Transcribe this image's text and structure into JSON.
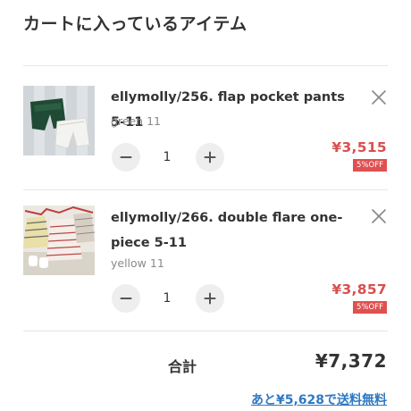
{
  "page": {
    "title": "カートに入っているアイテム"
  },
  "cart": {
    "items": [
      {
        "name": "ellymolly/256. flap pocket pants 5-11",
        "variant": "green 11",
        "quantity": "1",
        "price": "¥3,515",
        "discount_badge": "5%OFF"
      },
      {
        "name": "ellymolly/266. double flare one-piece 5-11",
        "variant": "yellow 11",
        "quantity": "1",
        "price": "¥3,857",
        "discount_badge": "5%OFF"
      }
    ],
    "total_label": "合計",
    "total_value": "¥7,372",
    "free_shipping_text": "あと¥5,628で送料無料"
  },
  "colors": {
    "price": "#d94f4f",
    "badge_bg": "#e05050",
    "link": "#2f79c2",
    "stepper_bg": "#eeeeee"
  },
  "icons": {
    "remove": "close-icon",
    "decrease": "minus-icon",
    "increase": "plus-icon"
  }
}
